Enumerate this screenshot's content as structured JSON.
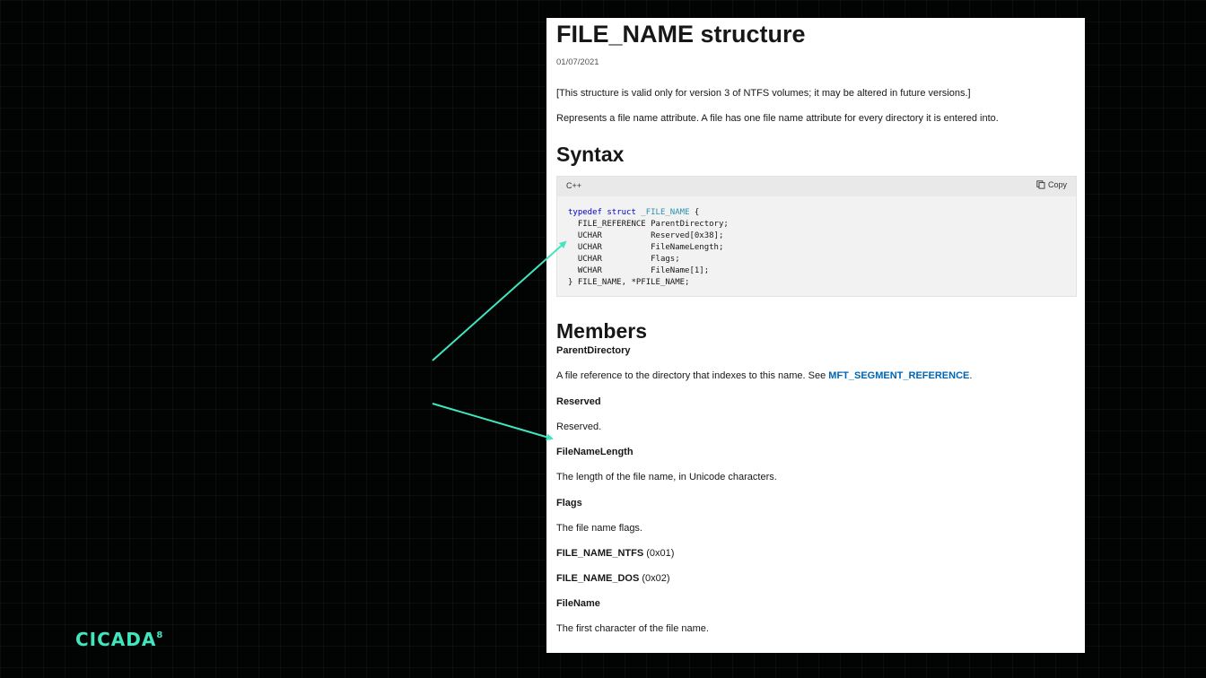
{
  "doc": {
    "title": "FILE_NAME structure",
    "date": "01/07/2021",
    "note": "[This structure is valid only for version 3 of NTFS volumes; it may be altered in future versions.]",
    "description": "Represents a file name attribute. A file has one file name attribute for every directory it is entered into."
  },
  "syntax": {
    "heading": "Syntax",
    "language": "C++",
    "copy_label": "Copy",
    "code": {
      "kw_typedef": "typedef",
      "kw_struct": "struct",
      "struct_name": "_FILE_NAME",
      "brace_open": " {",
      "lines": [
        "  FILE_REFERENCE ParentDirectory;",
        "  UCHAR          Reserved[0x38];",
        "  UCHAR          FileNameLength;",
        "  UCHAR          Flags;",
        "  WCHAR          FileName[1];"
      ],
      "closing": "} FILE_NAME, *PFILE_NAME;"
    }
  },
  "members": {
    "heading": "Members",
    "parent_directory": {
      "name": "ParentDirectory",
      "desc_prefix": "A file reference to the directory that indexes to this name. See ",
      "link": "MFT_SEGMENT_REFERENCE",
      "desc_suffix": "."
    },
    "reserved": {
      "name": "Reserved",
      "desc": "Reserved."
    },
    "file_name_length": {
      "name": "FileNameLength",
      "desc": "The length of the file name, in Unicode characters."
    },
    "flags": {
      "name": "Flags",
      "desc": "The file name flags.",
      "values": [
        {
          "name": "FILE_NAME_NTFS",
          "value": "(0x01)"
        },
        {
          "name": "FILE_NAME_DOS",
          "value": "(0x02)"
        }
      ]
    },
    "file_name": {
      "name": "FileName",
      "desc": "The first character of the file name."
    }
  },
  "brand": {
    "logo_text": "CICADA",
    "logo_sup": "8"
  },
  "colors": {
    "arrow": "#3fe6be",
    "link": "#0065b3",
    "code_keyword": "#0000cc",
    "code_type": "#2b91af"
  }
}
